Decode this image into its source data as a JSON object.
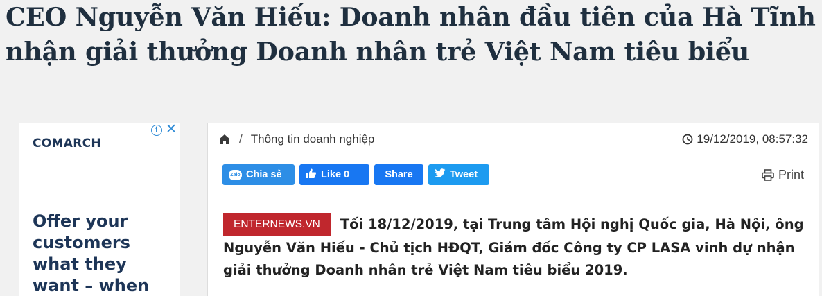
{
  "article": {
    "headline": "CEO Nguyễn Văn Hiếu: Doanh nhân đầu tiên của Hà Tĩnh nhận giải thưởng Doanh nhân trẻ Việt Nam tiêu biểu",
    "breadcrumb": {
      "separator": "/",
      "category": "Thông tin doanh nghiệp"
    },
    "timestamp": "19/12/2019, 08:57:32",
    "source_badge": "ENTERNEWS.VN",
    "lead": "Tối 18/12/2019, tại Trung tâm Hội nghị Quốc gia, Hà Nội, ông Nguyễn Văn Hiếu - Chủ tịch HĐQT, Giám đốc Công ty CP LASA vinh dự nhận giải thưởng Doanh nhân trẻ Việt Nam tiêu biểu 2019."
  },
  "social": {
    "zalo_label": "Chia sẻ",
    "zalo_badge": "Zalo",
    "like_label": "Like 0",
    "share_label": "Share",
    "tweet_label": "Tweet",
    "print_label": "Print"
  },
  "ad": {
    "brand": "COMARCH",
    "info_symbol": "i",
    "close_symbol": "✕",
    "copy": "Offer your customers what they want – when"
  },
  "icons": {
    "home": "home-icon",
    "clock": "clock-icon",
    "facebook": "facebook-thumb-icon",
    "twitter": "twitter-bird-icon",
    "print": "printer-icon",
    "ad_info": "info-icon",
    "ad_close": "close-icon"
  },
  "colors": {
    "page_background": "#f1f1f1",
    "headline": "#1f2f3f",
    "source_badge": "#c0272d",
    "facebook": "#1877f2",
    "twitter": "#1d9bf0",
    "zalo": "#2d8ee6",
    "ad_text": "#1d3557"
  }
}
